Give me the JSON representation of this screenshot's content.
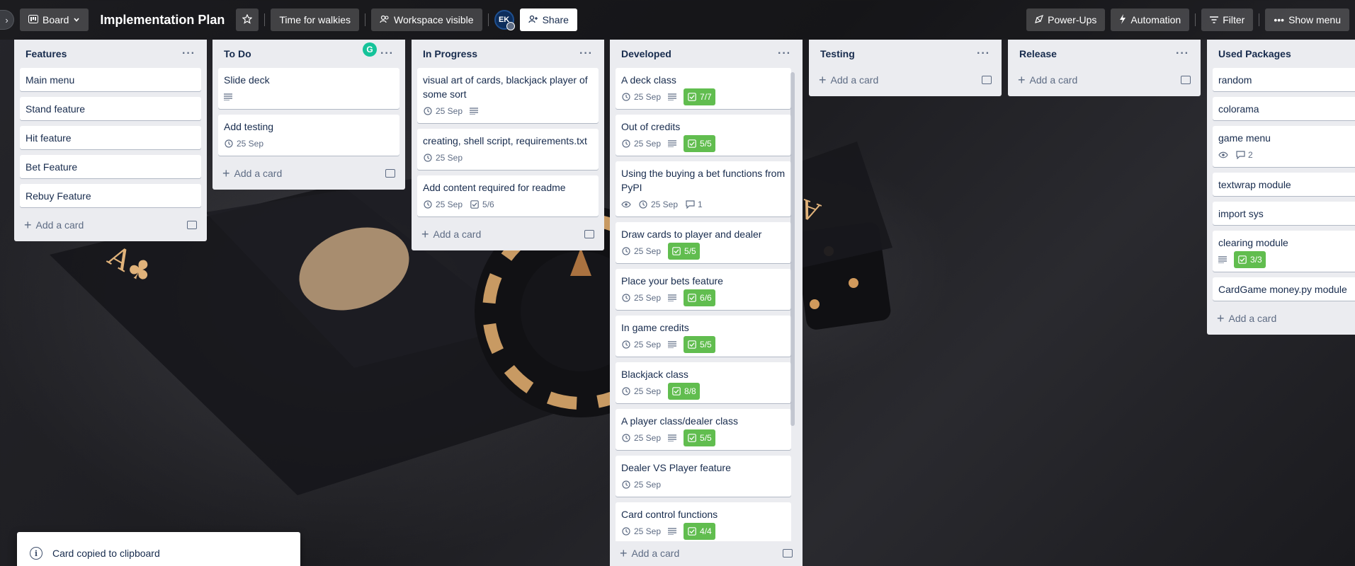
{
  "header": {
    "sidebar_toggle": "›",
    "view_label": "Board",
    "title": "Implementation Plan",
    "workspace_name": "Time for walkies",
    "visibility_label": "Workspace visible",
    "avatar_initials": "EK",
    "share_label": "Share",
    "powerups_label": "Power-Ups",
    "automation_label": "Automation",
    "filter_label": "Filter",
    "show_menu_label": "Show menu"
  },
  "lists": [
    {
      "title": "Features",
      "cards": [
        {
          "title": "Main menu"
        },
        {
          "title": "Stand feature"
        },
        {
          "title": "Hit feature"
        },
        {
          "title": "Bet Feature"
        },
        {
          "title": "Rebuy Feature"
        }
      ],
      "add_label": "Add a card"
    },
    {
      "title": "To Do",
      "cards": [
        {
          "title": "Slide deck",
          "description": true
        },
        {
          "title": "Add testing",
          "date": "25 Sep"
        }
      ],
      "add_label": "Add a card"
    },
    {
      "title": "In Progress",
      "cards": [
        {
          "title": "visual art of cards, blackjack player of some sort",
          "date": "25 Sep",
          "description": true
        },
        {
          "title": "creating, shell script, requirements.txt",
          "date": "25 Sep"
        },
        {
          "title": "Add content required for readme",
          "date": "25 Sep",
          "checklist": "5/6"
        }
      ],
      "add_label": "Add a card"
    },
    {
      "title": "Developed",
      "cards": [
        {
          "title": "A deck class",
          "date": "25 Sep",
          "description": true,
          "checklist": "7/7"
        },
        {
          "title": "Out of credits",
          "date": "25 Sep",
          "description": true,
          "checklist": "5/5"
        },
        {
          "title": "Using the buying a bet functions from PyPI",
          "watch": true,
          "date": "25 Sep",
          "comments": "1"
        },
        {
          "title": "Draw cards to player and dealer",
          "date": "25 Sep",
          "checklist": "5/5"
        },
        {
          "title": "Place your bets feature",
          "date": "25 Sep",
          "description": true,
          "checklist": "6/6"
        },
        {
          "title": "In game credits",
          "date": "25 Sep",
          "description": true,
          "checklist": "5/5"
        },
        {
          "title": "Blackjack class",
          "date": "25 Sep",
          "checklist": "8/8"
        },
        {
          "title": "A player class/dealer class",
          "date": "25 Sep",
          "description": true,
          "checklist": "5/5"
        },
        {
          "title": "Dealer VS Player feature",
          "date": "25 Sep"
        },
        {
          "title": "Card control functions",
          "date": "25 Sep",
          "description": true,
          "checklist": "4/4"
        }
      ],
      "add_label": "Add a card"
    },
    {
      "title": "Testing",
      "cards": [],
      "add_label": "Add a card"
    },
    {
      "title": "Release",
      "cards": [],
      "add_label": "Add a card"
    },
    {
      "title": "Used Packages",
      "cards": [
        {
          "title": "random"
        },
        {
          "title": "colorama"
        },
        {
          "title": "game menu",
          "watch": true,
          "comments": "2"
        },
        {
          "title": "textwrap module"
        },
        {
          "title": "import sys"
        },
        {
          "title": "clearing module",
          "description": true,
          "checklist": "3/3"
        },
        {
          "title": "CardGame money.py module"
        }
      ],
      "add_label": "Add a card"
    }
  ],
  "toast": {
    "message": "Card copied to clipboard"
  },
  "colors": {
    "list_bg": "#ebecf0",
    "checklist_complete": "#61bd4f",
    "grammarly": "#15c39a"
  }
}
